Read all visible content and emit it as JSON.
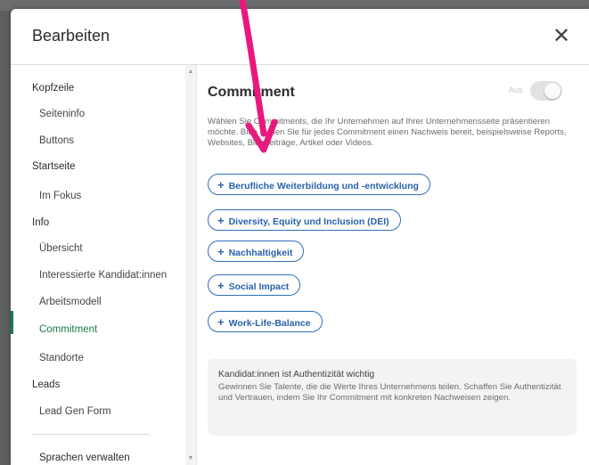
{
  "dialog": {
    "title": "Bearbeiten",
    "close_icon": "close-icon"
  },
  "sidebar": {
    "items": [
      {
        "label": "Kopfzeile",
        "type": "section"
      },
      {
        "label": "Seiteninfo",
        "type": "sub"
      },
      {
        "label": "Buttons",
        "type": "sub"
      },
      {
        "label": "Startseite",
        "type": "section"
      },
      {
        "label": "Im Fokus",
        "type": "sub"
      },
      {
        "label": "Info",
        "type": "section"
      },
      {
        "label": "Übersicht",
        "type": "sub"
      },
      {
        "label": "Interessierte Kandidat:innen",
        "type": "sub"
      },
      {
        "label": "Arbeitsmodell",
        "type": "sub"
      },
      {
        "label": "Commitment",
        "type": "sub",
        "active": true
      },
      {
        "label": "Standorte",
        "type": "sub"
      },
      {
        "label": "Leads",
        "type": "section"
      },
      {
        "label": "Lead Gen Form",
        "type": "sub"
      },
      {
        "label": "Sprachen verwalten",
        "type": "section"
      }
    ],
    "active_color": "#1f7a52"
  },
  "content": {
    "title": "Commitment",
    "toggle_label": "Aus",
    "description": "Wählen Sie Commitments, die Ihr Unternehmen auf Ihrer Unternehmensseite präsentieren möchte. Bitte stellen Sie für jedes Commitment einen Nachweis bereit, beispielsweise Reports, Websites, Blogbeiträge, Artikel oder Videos.",
    "commitments": [
      "Berufliche Weiterbildung und -entwicklung",
      "Diversity, Equity und Inclusion (DEI)",
      "Nachhaltigkeit",
      "Social Impact",
      "Work-Life-Balance"
    ],
    "info_card": {
      "title": "Kandidat:innen ist Authentizität wichtig",
      "text": "Gewinnen Sie Talente, die die Werte Ihres Unternehmens teilen. Schaffen Sie Authentizität und Vertrauen, indem Sie Ihr Commitment mit konkreten Nachweisen zeigen."
    }
  },
  "annotation": {
    "arrow_color": "#e8197d"
  },
  "colors": {
    "accent_blue": "#2f6fb8",
    "backdrop": "#5d5f61"
  }
}
